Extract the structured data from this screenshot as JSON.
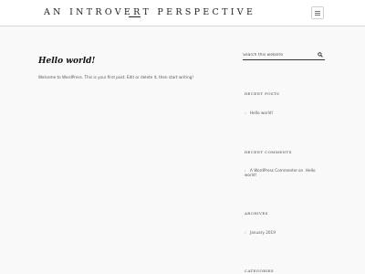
{
  "header": {
    "site_title": "AN INTROVERT PERSPECTIVE"
  },
  "post": {
    "title": "Hello world!",
    "content": "Welcome to WordPress. This is your first post. Edit or delete it, then start writing!"
  },
  "sidebar": {
    "search": {
      "placeholder": "Search this website"
    },
    "recent_posts": {
      "title": "RECENT POSTS",
      "items": [
        "Hello world!"
      ]
    },
    "recent_comments": {
      "title": "RECENT COMMENTS",
      "items": [
        {
          "author": "A WordPress Commenter",
          "connector": "on",
          "post_line1": "Hello",
          "post_line2": "world!"
        }
      ]
    },
    "archives": {
      "title": "ARCHIVES",
      "items": [
        "January 2019"
      ]
    },
    "categories": {
      "title": "CATEGORIES"
    }
  },
  "colors": {
    "background": "#f9f9f9",
    "header": "#ffffff",
    "text": "#222222"
  },
  "icons": [
    "menu-icon",
    "search-icon"
  ]
}
